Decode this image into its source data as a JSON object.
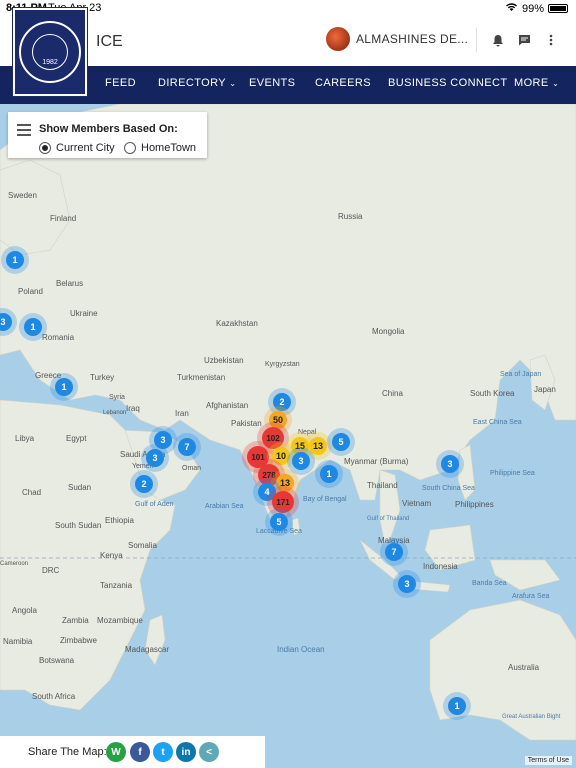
{
  "status_bar": {
    "time": "8:11 PM",
    "date": "Tue Apr 23",
    "battery": "99%"
  },
  "app": {
    "title": "ICE",
    "user_name": "ALMASHINES DE...",
    "logo_year": "1982"
  },
  "nav": {
    "items": [
      {
        "label": "FEED",
        "chevron": false
      },
      {
        "label": "DIRECTORY",
        "chevron": true
      },
      {
        "label": "EVENTS",
        "chevron": false
      },
      {
        "label": "CAREERS",
        "chevron": false
      },
      {
        "label": "BUSINESS CONNECT",
        "chevron": false
      },
      {
        "label": "MORE",
        "chevron": true
      }
    ]
  },
  "filter": {
    "title": "Show Members Based On:",
    "options": [
      {
        "label": "Current City",
        "selected": true
      },
      {
        "label": "HomeTown",
        "selected": false
      }
    ]
  },
  "map": {
    "labels": [
      "Sweden",
      "Finland",
      "Russia",
      "Belarus",
      "Poland",
      "Ukraine",
      "Romania",
      "Kazakhstan",
      "Mongolia",
      "Uzbekistan",
      "Kyrgyzstan",
      "Turkmenistan",
      "Greece",
      "Turkey",
      "Syria",
      "Iraq",
      "Iran",
      "Afghanistan",
      "Pakistan",
      "Nepal",
      "China",
      "South Korea",
      "Japan",
      "Sea of Japan",
      "East China Sea",
      "Libya",
      "Egypt",
      "Saudi Arabia",
      "Oman",
      "Myanmar (Burma)",
      "Philippine Sea",
      "Chad",
      "Sudan",
      "Arabian Sea",
      "Bay of Bengal",
      "Thailand",
      "South China Sea",
      "Gulf of Aden",
      "Gulf of Thailand",
      "Vietnam",
      "Philippines",
      "South Sudan",
      "Ethiopia",
      "Laccadive Sea",
      "Somalia",
      "Malaysia",
      "Kenya",
      "DRC",
      "Indonesia",
      "Tanzania",
      "Banda Sea",
      "Arafura Sea",
      "Angola",
      "Mozambique",
      "Zambia",
      "Zimbabwe",
      "Namibia",
      "Madagascar",
      "Botswana",
      "Indian Ocean",
      "Australia",
      "South Africa",
      "Great Australian Bight",
      "Yemen",
      "Lebanon",
      "Cameroon"
    ],
    "clusters": [
      {
        "count": "1",
        "color": "#1e88e5"
      },
      {
        "count": "3",
        "color": "#1e88e5"
      },
      {
        "count": "1",
        "color": "#1e88e5"
      },
      {
        "count": "1",
        "color": "#1e88e5"
      },
      {
        "count": "2",
        "color": "#1e88e5"
      },
      {
        "count": "50",
        "color": "#f5a623"
      },
      {
        "count": "102",
        "color": "#e53935"
      },
      {
        "count": "15",
        "color": "#f5c518"
      },
      {
        "count": "13",
        "color": "#f5c518"
      },
      {
        "count": "5",
        "color": "#1e88e5"
      },
      {
        "count": "101",
        "color": "#e53935"
      },
      {
        "count": "10",
        "color": "#f5c518"
      },
      {
        "count": "3",
        "color": "#1e88e5"
      },
      {
        "count": "278",
        "color": "#e53935"
      },
      {
        "count": "13",
        "color": "#f5a623"
      },
      {
        "count": "1",
        "color": "#1e88e5"
      },
      {
        "count": "4",
        "color": "#1e88e5"
      },
      {
        "count": "171",
        "color": "#e53935"
      },
      {
        "count": "5",
        "color": "#1e88e5"
      },
      {
        "count": "3",
        "color": "#1e88e5"
      },
      {
        "count": "3",
        "color": "#1e88e5"
      },
      {
        "count": "7",
        "color": "#1e88e5"
      },
      {
        "count": "2",
        "color": "#1e88e5"
      },
      {
        "count": "3",
        "color": "#1e88e5"
      },
      {
        "count": "7",
        "color": "#1e88e5"
      },
      {
        "count": "3",
        "color": "#1e88e5"
      },
      {
        "count": "1",
        "color": "#1e88e5"
      }
    ],
    "terms": "Terms of Use"
  },
  "share": {
    "label": "Share The Map:",
    "buttons": [
      {
        "name": "whatsapp",
        "glyph": "W",
        "color": "#25a244"
      },
      {
        "name": "facebook",
        "glyph": "f",
        "color": "#3b5998"
      },
      {
        "name": "twitter",
        "glyph": "t",
        "color": "#1da1f2"
      },
      {
        "name": "linkedin",
        "glyph": "in",
        "color": "#0e76a8"
      },
      {
        "name": "share",
        "glyph": "<",
        "color": "#5fa8b8"
      }
    ]
  }
}
